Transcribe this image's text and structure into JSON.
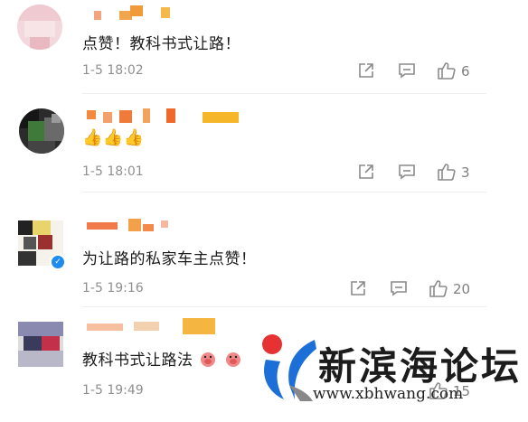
{
  "comments": [
    {
      "text": "点赞！教科书式让路！",
      "time": "1-5 18:02",
      "likes": "6",
      "likes_icon": "thumbs-up-icon",
      "emoji_count": 0
    },
    {
      "text": "",
      "time": "1-5 18:01",
      "likes": "3",
      "likes_icon": "thumbs-up-icon",
      "emoji": "👍👍👍"
    },
    {
      "text": "为让路的私家车主点赞！",
      "time": "1-5 19:16",
      "likes": "20",
      "likes_icon": "thumbs-up-icon",
      "verified": true
    },
    {
      "text": "教科书式让路法",
      "time": "1-5 19:49",
      "likes": "15",
      "likes_icon": "thumbs-up-icon"
    }
  ],
  "watermark": {
    "title": "新滨海论坛",
    "url": "www.xbhwang.com",
    "colors": {
      "red": "#e63232",
      "blue": "#1c6fd6",
      "gray": "#888888"
    }
  },
  "icons": {
    "share": "share-icon",
    "comment": "comment-icon",
    "like": "thumbs-up-icon"
  }
}
